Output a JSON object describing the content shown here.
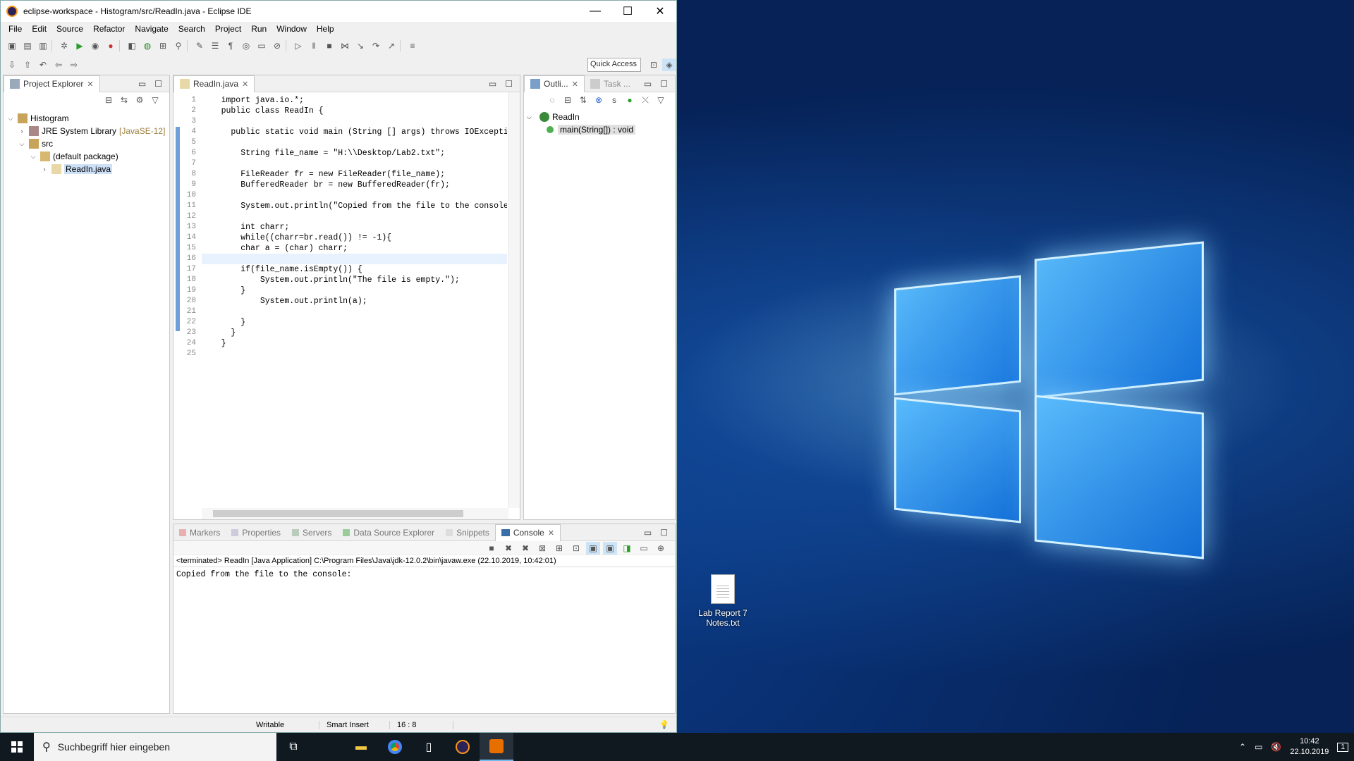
{
  "window": {
    "title": "eclipse-workspace - Histogram/src/ReadIn.java - Eclipse IDE",
    "minimize": "—",
    "maximize": "☐",
    "close": "✕"
  },
  "menu": [
    "File",
    "Edit",
    "Source",
    "Refactor",
    "Navigate",
    "Search",
    "Project",
    "Run",
    "Window",
    "Help"
  ],
  "quick_access": "Quick Access",
  "project_explorer": {
    "tab_label": "Project Explorer",
    "tree": [
      {
        "label": "Histogram",
        "caret": "⌵",
        "indent": 0
      },
      {
        "label": "JRE System Library",
        "extra": "[JavaSE-12]",
        "caret": "›",
        "indent": 1
      },
      {
        "label": "src",
        "caret": "⌵",
        "indent": 1
      },
      {
        "label": "(default package)",
        "caret": "⌵",
        "indent": 2
      },
      {
        "label": "ReadIn.java",
        "caret": "›",
        "indent": 3,
        "selected": true
      }
    ]
  },
  "editor": {
    "tab_label": "ReadIn.java",
    "line_numbers": [
      "1",
      "2",
      "3",
      "4",
      "5",
      "6",
      "7",
      "8",
      "9",
      "10",
      "11",
      "12",
      "13",
      "14",
      "15",
      "16",
      "17",
      "18",
      "19",
      "20",
      "21",
      "22",
      "23",
      "24",
      "25"
    ],
    "code": [
      "    import java.io.*;",
      "    public class ReadIn {",
      "",
      "      public static void main (String [] args) throws IOException",
      "",
      "        String file_name = \"H:\\\\Desktop/Lab2.txt\";",
      "",
      "        FileReader fr = new FileReader(file_name);",
      "        BufferedReader br = new BufferedReader(fr);",
      "",
      "        System.out.println(\"Copied from the file to the console:\");",
      "",
      "        int charr;",
      "        while((charr=br.read()) != -1){",
      "        char a = (char) charr;",
      "        ",
      "        if(file_name.isEmpty()) {",
      "            System.out.println(\"The file is empty.\");",
      "        }",
      "            System.out.println(a);",
      "",
      "        }",
      "      }",
      "    }",
      ""
    ]
  },
  "outline": {
    "tab_label": "Outli...",
    "tab2_label": "Task ...",
    "items": [
      {
        "label": "ReadIn"
      },
      {
        "label": "main(String[]) : void"
      }
    ]
  },
  "bottom_tabs": [
    "Markers",
    "Properties",
    "Servers",
    "Data Source Explorer",
    "Snippets",
    "Console"
  ],
  "console": {
    "status": "<terminated> ReadIn [Java Application] C:\\Program Files\\Java\\jdk-12.0.2\\bin\\javaw.exe (22.10.2019, 10:42:01)",
    "output": "Copied from the file to the console:"
  },
  "statusbar": {
    "mode": "Writable",
    "insert": "Smart Insert",
    "position": "16 : 8"
  },
  "desktop": {
    "icon_label": "Lab Report 7 Notes.txt"
  },
  "taskbar": {
    "search_placeholder": "Suchbegriff hier eingeben",
    "time": "10:42",
    "date": "22.10.2019",
    "notifications": "1"
  }
}
